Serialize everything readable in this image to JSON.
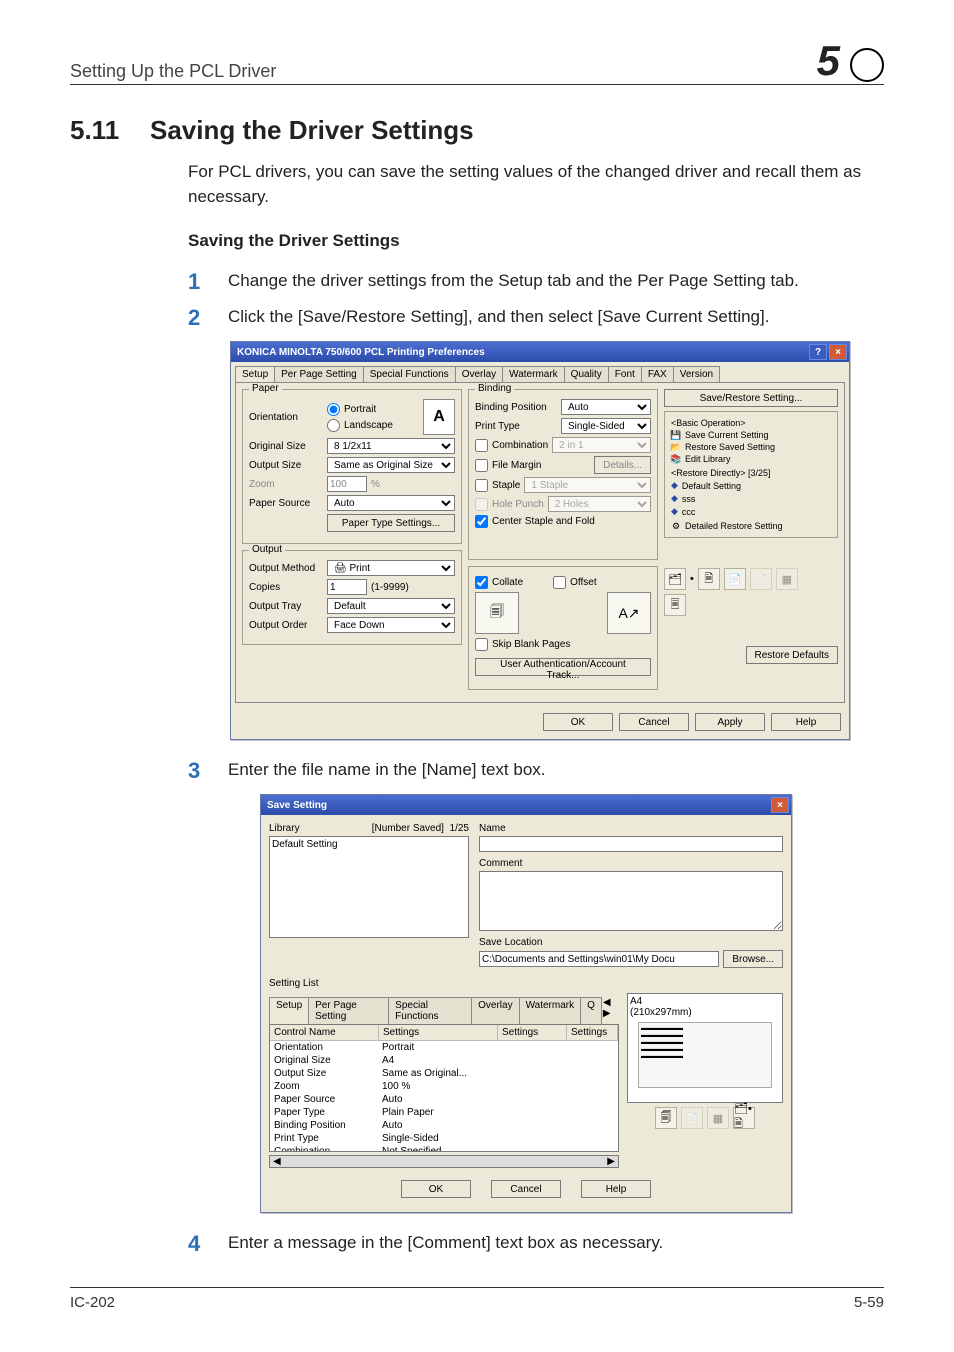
{
  "header": {
    "title": "Setting Up the PCL Driver",
    "chapter": "5"
  },
  "h1": {
    "num": "5.11",
    "title": "Saving the Driver Settings"
  },
  "intro": "For PCL drivers, you can save the setting values of the changed driver and recall them as necessary.",
  "subheading": "Saving the Driver Settings",
  "steps": [
    {
      "n": "1",
      "text": "Change the driver settings from the Setup tab and the Per Page Setting tab."
    },
    {
      "n": "2",
      "text": "Click the [Save/Restore Setting], and then select [Save Current Setting]."
    },
    {
      "n": "3",
      "text": "Enter the file name in the [Name] text box."
    },
    {
      "n": "4",
      "text": "Enter a message in the [Comment] text box as necessary."
    }
  ],
  "dlg1": {
    "title": "KONICA MINOLTA 750/600 PCL Printing Preferences",
    "help": "?",
    "close": "×",
    "tabs": [
      "Setup",
      "Per Page Setting",
      "Special Functions",
      "Overlay",
      "Watermark",
      "Quality",
      "Font",
      "FAX",
      "Version"
    ],
    "paper": {
      "title": "Paper",
      "orientation_label": "Orientation",
      "portrait": "Portrait",
      "landscape": "Landscape",
      "orient_glyph": "A",
      "original_size_label": "Original Size",
      "original_size": "8 1/2x11",
      "output_size_label": "Output Size",
      "output_size": "Same as Original Size",
      "zoom_label": "Zoom",
      "zoom_val": "100",
      "zoom_unit": "%",
      "paper_source_label": "Paper Source",
      "paper_source": "Auto",
      "paper_type_btn": "Paper Type Settings..."
    },
    "output": {
      "title": "Output",
      "method_label": "Output Method",
      "method": "Print",
      "copies_label": "Copies",
      "copies": "1",
      "copies_range": "(1-9999)",
      "tray_label": "Output Tray",
      "tray": "Default",
      "order_label": "Output Order",
      "order": "Face Down"
    },
    "binding": {
      "title": "Binding",
      "pos_label": "Binding Position",
      "pos": "Auto",
      "ptype_label": "Print Type",
      "ptype": "Single-Sided",
      "combination": "Combination",
      "combination_val": "2 in 1",
      "file_margin": "File Margin",
      "details": "Details...",
      "staple": "Staple",
      "staple_val": "1 Staple",
      "hole_punch": "Hole Punch",
      "hole_val": "2 Holes",
      "center": "Center Staple and Fold"
    },
    "collate_group": {
      "collate": "Collate",
      "offset": "Offset",
      "skip": "Skip Blank Pages",
      "ua_btn": "User Authentication/Account Track...",
      "pages_glyph": "🗐",
      "arrow_glyph": "A↗"
    },
    "restore": {
      "btn": "Save/Restore Setting...",
      "group": "<Basic Operation>",
      "save_current": "Save Current Setting",
      "restore_saved": "Restore Saved Setting",
      "edit_lib": "Edit Library",
      "direct": "<Restore Directly>   [3/25]",
      "default": "Default Setting",
      "sss": "sss",
      "ccc": "ccc",
      "detailed": "Detailed Restore Setting",
      "restore_defaults": "Restore Defaults"
    },
    "bottom": {
      "ok": "OK",
      "cancel": "Cancel",
      "apply": "Apply",
      "help": "Help"
    }
  },
  "dlg2": {
    "title": "Save Setting",
    "close": "×",
    "library": "Library",
    "num_saved": "[Number Saved]",
    "num_val": "1/25",
    "lib_item": "Default Setting",
    "name": "Name",
    "comment": "Comment",
    "save_loc": "Save Location",
    "loc_val": "C:\\Documents and Settings\\win01\\My Docu",
    "browse": "Browse...",
    "setting_list": "Setting List",
    "tabs": [
      "Setup",
      "Per Page Setting",
      "Special Functions",
      "Overlay",
      "Watermark",
      "Q"
    ],
    "preview": {
      "line1": "A4",
      "line2": "(210x297mm)"
    },
    "headers": [
      "Control Name",
      "Settings",
      "Settings",
      "Settings"
    ],
    "rows": [
      [
        "Orientation",
        "Portrait"
      ],
      [
        "Original Size",
        "A4"
      ],
      [
        "Output Size",
        "Same as Original..."
      ],
      [
        "Zoom",
        "100 %"
      ],
      [
        "Paper Source",
        "Auto"
      ],
      [
        "Paper Type",
        "Plain Paper"
      ],
      [
        "Binding Position",
        "Auto"
      ],
      [
        "Print Type",
        "Single-Sided"
      ],
      [
        "Combination",
        "Not Specified"
      ]
    ],
    "buttons": {
      "ok": "OK",
      "cancel": "Cancel",
      "help": "Help"
    }
  },
  "footer": {
    "left": "IC-202",
    "right": "5-59"
  }
}
